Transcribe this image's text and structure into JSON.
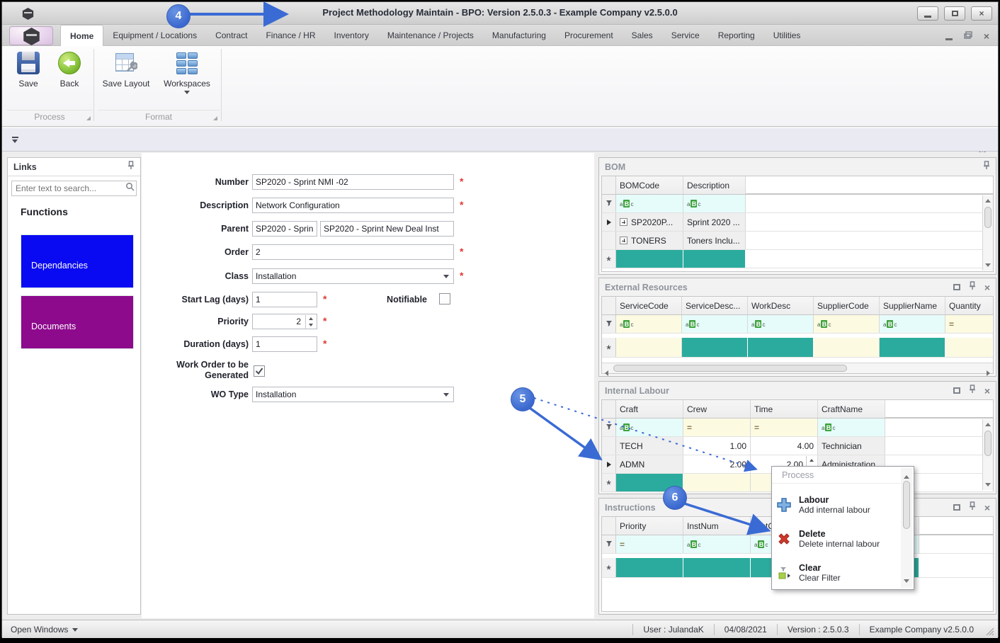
{
  "window": {
    "title": "Project Methodology Maintain - BPO: Version 2.5.0.3 - Example Company v2.5.0.0"
  },
  "menu": {
    "tabs": [
      {
        "label": "Home",
        "active": true
      },
      {
        "label": "Equipment / Locations"
      },
      {
        "label": "Contract"
      },
      {
        "label": "Finance / HR"
      },
      {
        "label": "Inventory"
      },
      {
        "label": "Maintenance / Projects"
      },
      {
        "label": "Manufacturing"
      },
      {
        "label": "Procurement"
      },
      {
        "label": "Sales"
      },
      {
        "label": "Service"
      },
      {
        "label": "Reporting"
      },
      {
        "label": "Utilities"
      }
    ]
  },
  "ribbon": {
    "save": "Save",
    "back": "Back",
    "save_layout": "Save Layout",
    "workspaces": "Workspaces",
    "group_process": "Process",
    "group_format": "Format"
  },
  "links": {
    "title": "Links",
    "search_placeholder": "Enter text to search...",
    "heading": "Functions",
    "items": [
      {
        "label": "Dependancies",
        "color": "#0a0af2"
      },
      {
        "label": "Documents",
        "color": "#8d0a8d"
      }
    ]
  },
  "form": {
    "required_marker": "*",
    "number": {
      "label": "Number",
      "value": "SP2020 - Sprint NMI -02"
    },
    "description": {
      "label": "Description",
      "value": "Network Configuration"
    },
    "parent": {
      "label": "Parent",
      "value1": "SP2020 - Sprin",
      "value2": "SP2020 - Sprint New Deal Inst"
    },
    "order": {
      "label": "Order",
      "value": "2"
    },
    "class": {
      "label": "Class",
      "value": "Installation"
    },
    "start_lag": {
      "label": "Start Lag (days)",
      "value": "1"
    },
    "notifiable": {
      "label": "Notifiable",
      "checked": false
    },
    "priority": {
      "label": "Priority",
      "value": "2"
    },
    "duration": {
      "label": "Duration (days)",
      "value": "1"
    },
    "wo_generated": {
      "label": "Work Order to be Generated",
      "checked": true
    },
    "wo_type": {
      "label": "WO Type",
      "value": "Installation"
    }
  },
  "bom": {
    "title": "BOM",
    "columns": [
      "BOMCode",
      "Description"
    ],
    "rows": [
      {
        "code": "SP2020P...",
        "desc": "Sprint 2020 ..."
      },
      {
        "code": "TONERS",
        "desc": "Toners Inclu..."
      }
    ]
  },
  "external": {
    "title": "External Resources",
    "columns": [
      "ServiceCode",
      "ServiceDesc...",
      "WorkDesc",
      "SupplierCode",
      "SupplierName",
      "Quantity"
    ]
  },
  "labour": {
    "title": "Internal Labour",
    "columns": [
      "Craft",
      "Crew",
      "Time",
      "CraftName"
    ],
    "rows": [
      {
        "craft": "TECH",
        "crew": "1.00",
        "time": "4.00",
        "name": "Technician"
      },
      {
        "craft": "ADMN",
        "crew": "2.00",
        "time": "2.00",
        "name": "Administration"
      }
    ]
  },
  "instructions": {
    "title": "Instructions",
    "columns": [
      "Priority",
      "InstNum",
      "InstCl"
    ]
  },
  "context_menu": {
    "header": "Process",
    "items": [
      {
        "title": "Labour",
        "subtitle": "Add internal labour"
      },
      {
        "title": "Delete",
        "subtitle": "Delete internal labour"
      },
      {
        "title": "Clear",
        "subtitle": "Clear Filter"
      }
    ]
  },
  "callouts": {
    "four": "4",
    "five": "5",
    "six": "6"
  },
  "status": {
    "open_windows": "Open Windows",
    "user": "User : JulandaK",
    "date": "04/08/2021",
    "version": "Version : 2.5.0.3",
    "company": "Example Company v2.5.0.0"
  },
  "icons": {
    "abc": [
      "a",
      "B",
      "c"
    ],
    "equals": "=",
    "asterisk": "*",
    "close": "×"
  },
  "colors": {
    "accent_blue": "#3a6bd4",
    "teal": "#2bab9d",
    "filter_cyan": "#e6fcfb",
    "filter_yellow": "#fcfbe2",
    "required_red": "#e03a35"
  }
}
